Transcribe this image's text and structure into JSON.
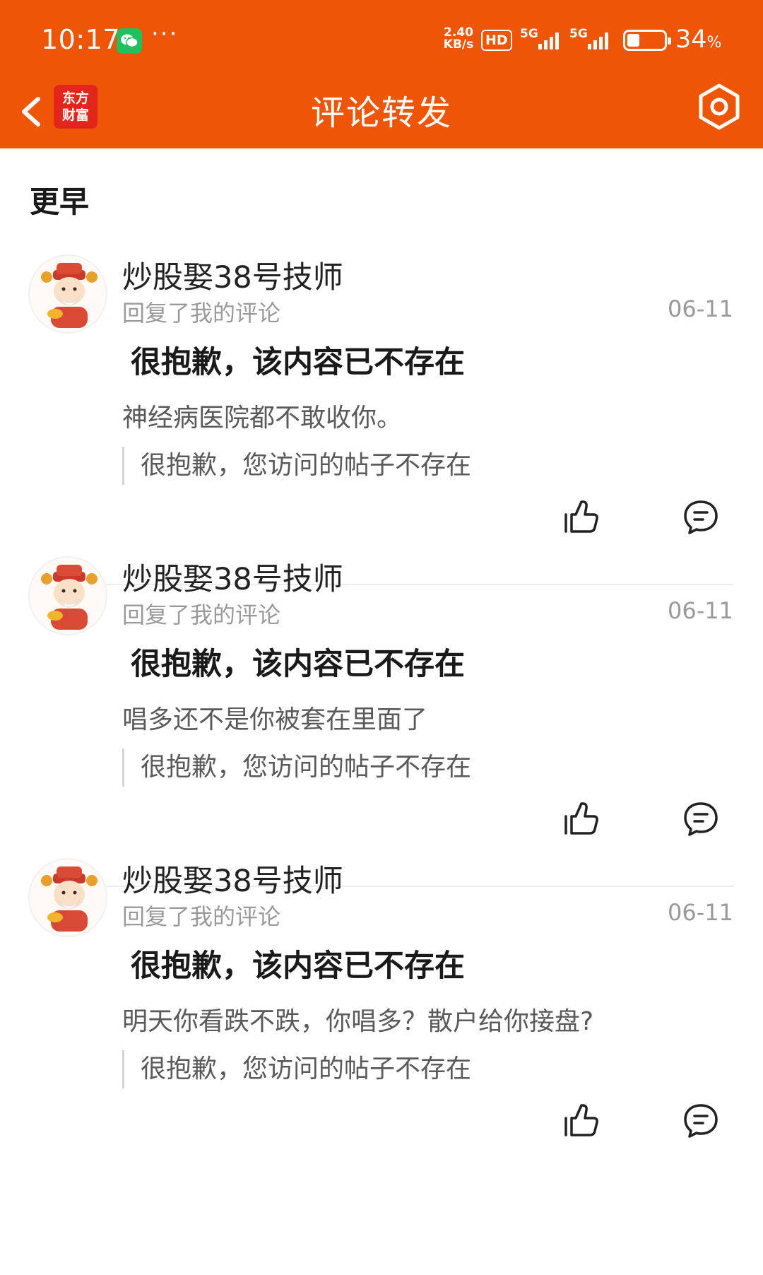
{
  "status_bar": {
    "time": "10:17",
    "dots": "···",
    "net_speed_value": "2.40",
    "net_speed_unit": "KB/s",
    "hd_label": "HD",
    "signal1_label": "5G",
    "signal2_label": "5G",
    "battery_percent": "34",
    "battery_percent_sign": "%",
    "battery_level": 0.34
  },
  "header": {
    "back_icon": "chevron-left-icon",
    "logo_line1": "东方",
    "logo_line2": "财富",
    "title": "评论转发",
    "settings_icon": "gear-icon"
  },
  "section": {
    "title": "更早"
  },
  "comments": [
    {
      "username": "炒股娶38号技师",
      "action": "回复了我的评论",
      "date": "06-11",
      "original": "很抱歉，该内容已不存在",
      "reply": "神经病医院都不敢收你。",
      "quote": "很抱歉，您访问的帖子不存在"
    },
    {
      "username": "炒股娶38号技师",
      "action": "回复了我的评论",
      "date": "06-11",
      "original": "很抱歉，该内容已不存在",
      "reply": "唱多还不是你被套在里面了",
      "quote": "很抱歉，您访问的帖子不存在"
    },
    {
      "username": "炒股娶38号技师",
      "action": "回复了我的评论",
      "date": "06-11",
      "original": "很抱歉，该内容已不存在",
      "reply": "明天你看跌不跌，你唱多？散户给你接盘?",
      "quote": "很抱歉，您访问的帖子不存在"
    }
  ],
  "colors": {
    "brand_orange": "#ee5506",
    "logo_red": "#e4251b",
    "wechat_green": "#1fc15f"
  }
}
